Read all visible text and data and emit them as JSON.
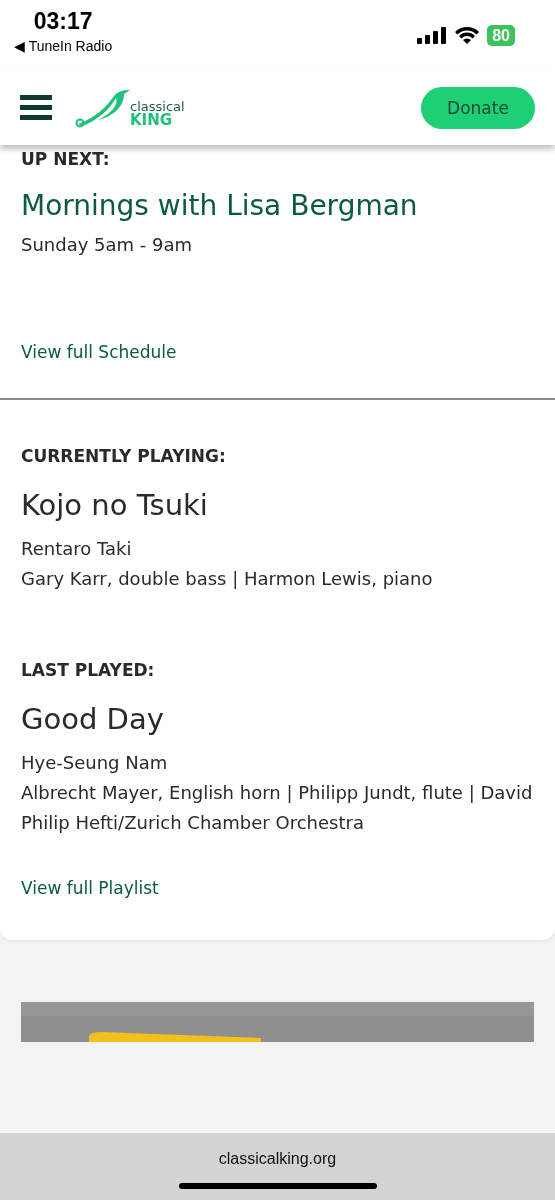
{
  "status_bar": {
    "time": "03:17",
    "back_app": "◀ TuneIn Radio",
    "battery": "80"
  },
  "header": {
    "logo_top": "classical",
    "logo_bottom": "KING",
    "donate": "Donate"
  },
  "up_next": {
    "heading": "UP NEXT:",
    "title": "Mornings with Lisa Bergman",
    "time": "Sunday 5am - 9am",
    "link": "View full Schedule"
  },
  "currently_playing": {
    "heading": "CURRENTLY PLAYING:",
    "title": "Kojo no Tsuki",
    "composer": "Rentaro Taki",
    "performers": "Gary Karr, double bass | Harmon Lewis, piano"
  },
  "last_played": {
    "heading": "LAST PLAYED:",
    "title": "Good Day",
    "composer": "Hye-Seung Nam",
    "performers": "Albrecht Mayer, English horn | Philipp Jundt, flute | David Philip Hefti/Zurich Chamber Orchestra",
    "link": "View full Playlist"
  },
  "url_bar": {
    "url": "classicalking.org"
  }
}
